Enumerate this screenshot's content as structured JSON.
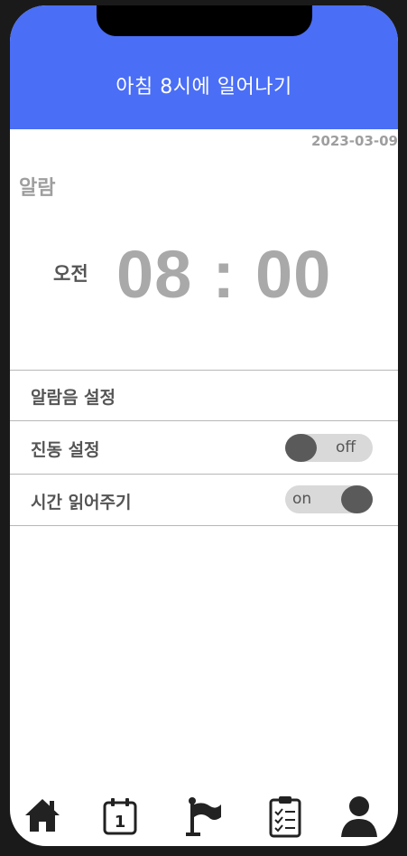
{
  "header": {
    "title": "아침 8시에 일어나기"
  },
  "date": "2023-03-09",
  "alarm": {
    "section_label": "알람",
    "ampm": "오전",
    "hour": "08",
    "separator": ":",
    "minute": "00"
  },
  "settings": {
    "sound_label": "알람음 설정",
    "vibration": {
      "label": "진동 설정",
      "state": "off"
    },
    "read_time": {
      "label": "시간 읽어주기",
      "state": "on"
    }
  },
  "tabbar": {
    "icons": [
      "home-icon",
      "calendar-icon",
      "flag-icon",
      "checklist-icon",
      "profile-icon"
    ],
    "calendar_day": "1"
  },
  "colors": {
    "header_bg": "#4a6ef5",
    "time_text": "#a9a9a9",
    "toggle_bg": "#d9d9d9",
    "toggle_knob": "#5a5a5a"
  }
}
